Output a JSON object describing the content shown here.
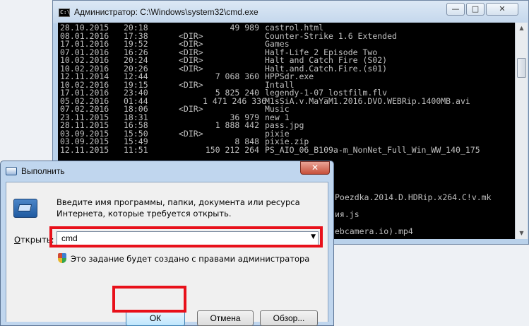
{
  "cmd": {
    "title": "Администратор: C:\\Windows\\system32\\cmd.exe",
    "icon_text": "C:\\",
    "minimize": "—",
    "maximize": "□",
    "close": "✕",
    "rows": [
      {
        "date": "28.10.2015",
        "time": "20:18",
        "dir": "",
        "size": "49 989",
        "name": "castrol.html"
      },
      {
        "date": "08.01.2016",
        "time": "17:38",
        "dir": "<DIR>",
        "size": "",
        "name": "Counter-Strike 1.6 Extended"
      },
      {
        "date": "17.01.2016",
        "time": "19:52",
        "dir": "<DIR>",
        "size": "",
        "name": "Games"
      },
      {
        "date": "07.01.2016",
        "time": "16:26",
        "dir": "<DIR>",
        "size": "",
        "name": "Half-Life 2 Episode Two"
      },
      {
        "date": "10.02.2016",
        "time": "20:24",
        "dir": "<DIR>",
        "size": "",
        "name": "Halt and Catch Fire (S02)"
      },
      {
        "date": "10.02.2016",
        "time": "20:26",
        "dir": "<DIR>",
        "size": "",
        "name": "Halt.and.Catch.Fire.(s01)"
      },
      {
        "date": "12.11.2014",
        "time": "12:44",
        "dir": "",
        "size": "7 068 360",
        "name": "HPPSdr.exe"
      },
      {
        "date": "10.02.2016",
        "time": "19:15",
        "dir": "<DIR>",
        "size": "",
        "name": "Intall"
      },
      {
        "date": "17.01.2016",
        "time": "23:40",
        "dir": "",
        "size": "5 825 240",
        "name": "legendy-1-07_lostfilm.flv"
      },
      {
        "date": "05.02.2016",
        "time": "01:44",
        "dir": "",
        "size": "1 471 246 336",
        "name": "M1sSiA.v.MaYaM1.2016.DVO.WEBRip.1400MB.avi"
      },
      {
        "date": "07.02.2016",
        "time": "18:06",
        "dir": "<DIR>",
        "size": "",
        "name": "Music"
      },
      {
        "date": "23.11.2015",
        "time": "18:31",
        "dir": "",
        "size": "36 979",
        "name": "new 1"
      },
      {
        "date": "28.11.2015",
        "time": "16:58",
        "dir": "",
        "size": "1 888 442",
        "name": "pass.jpg"
      },
      {
        "date": "03.09.2015",
        "time": "15:50",
        "dir": "<DIR>",
        "size": "",
        "name": "pixie"
      },
      {
        "date": "03.09.2015",
        "time": "15:49",
        "dir": "",
        "size": "8 848",
        "name": "pixie.zip"
      },
      {
        "date": "12.11.2015",
        "time": "11:51",
        "dir": "",
        "size": "150 212 264",
        "name": "PS_AIO_06_B109a-m_NonNet_Full_Win_WW_140_175"
      }
    ],
    "partial_lines": [
      "Poezdka.2014.D.HDRip.x264.C!v.mk",
      "ия.js",
      "ebcamera.io).mp4"
    ]
  },
  "run": {
    "title": "Выполнить",
    "close": "✕",
    "description_line1": "Введите имя программы, папки, документа или ресурса",
    "description_line2": "Интернета, которые требуется открыть.",
    "open_label_accel": "О",
    "open_label_rest": "ткрыть:",
    "open_value": "cmd",
    "admin_note": "Это задание будет создано с правами администратора",
    "ok": "ОК",
    "cancel": "Отмена",
    "browse": "Обзор..."
  },
  "colors": {
    "highlight": "#e8101a",
    "console_bg": "#000000",
    "console_fg": "#c0c0c0"
  }
}
